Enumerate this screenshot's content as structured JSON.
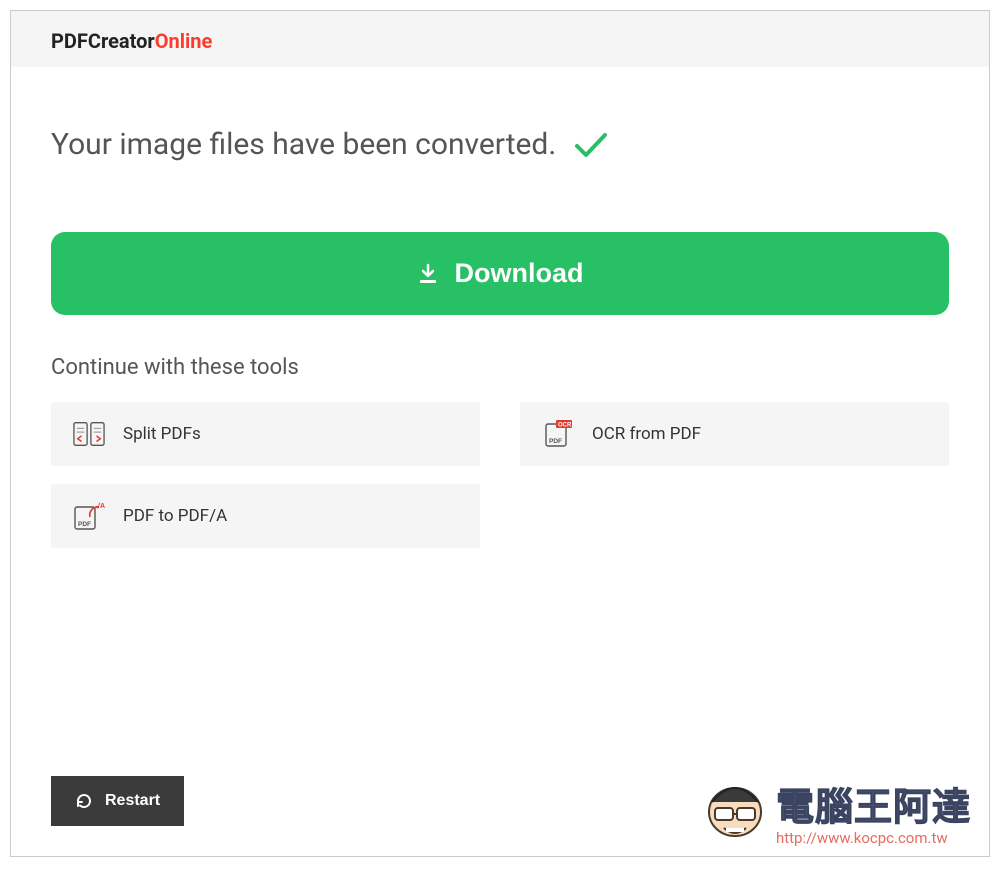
{
  "brand": {
    "part1": "PDFCreator",
    "part2": "Online"
  },
  "main": {
    "success_message": "Your image files have been converted.",
    "download_label": "Download",
    "continue_title": "Continue with these tools"
  },
  "tools": [
    {
      "label": "Split PDFs",
      "icon": "split-pdf-icon"
    },
    {
      "label": "OCR from PDF",
      "icon": "ocr-pdf-icon"
    },
    {
      "label": "PDF to PDF/A",
      "icon": "pdfa-icon"
    }
  ],
  "footer": {
    "restart_label": "Restart"
  },
  "watermark": {
    "text_cn": "電腦王阿達",
    "url": "http://www.kocpc.com.tw"
  },
  "colors": {
    "accent": "#27c065",
    "brand_red": "#fb3c2f",
    "dark": "#3b3b3b"
  }
}
